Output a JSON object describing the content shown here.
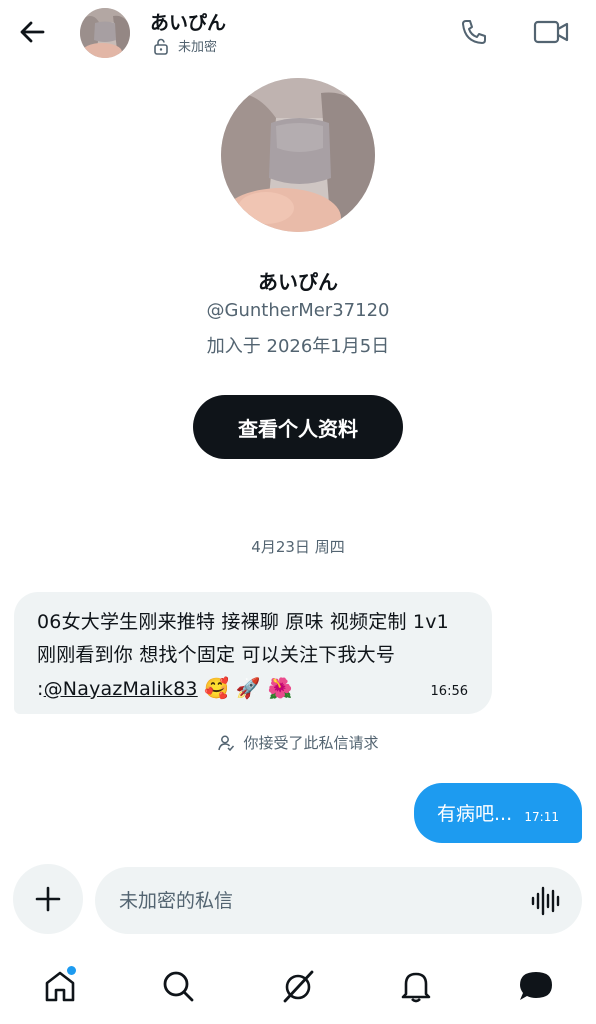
{
  "header": {
    "name": "あいぴん",
    "encryption_status": "未加密"
  },
  "profile": {
    "name": "あいぴん",
    "handle": "@GuntherMer37120",
    "joined": "加入于 2026年1月5日",
    "view_profile_label": "查看个人资料"
  },
  "conversation": {
    "date_divider": "4月23日 周四",
    "incoming": {
      "text_before": "06女大学生刚来推特 接裸聊 原味 视频定制 1v1 刚刚看到你  想找个固定  可以关注下我大号 :",
      "mention": "@NayazMalik83",
      "emojis": " 🥰 🚀 🌺",
      "time": "16:56"
    },
    "accepted_note": "你接受了此私信请求",
    "outgoing": {
      "text": "有病吧...",
      "time": "17:11"
    }
  },
  "composer": {
    "placeholder": "未加密的私信"
  },
  "colors": {
    "accent": "#1d9bf0",
    "primary_text": "#0f1419",
    "secondary_text": "#536471",
    "bubble_gray": "#eff3f4"
  },
  "icons": [
    "back-arrow-icon",
    "unlock-icon",
    "phone-icon",
    "video-icon",
    "plus-icon",
    "voice-waveform-icon",
    "home-icon",
    "search-icon",
    "grok-icon",
    "bell-icon",
    "messages-icon",
    "person-icon"
  ]
}
